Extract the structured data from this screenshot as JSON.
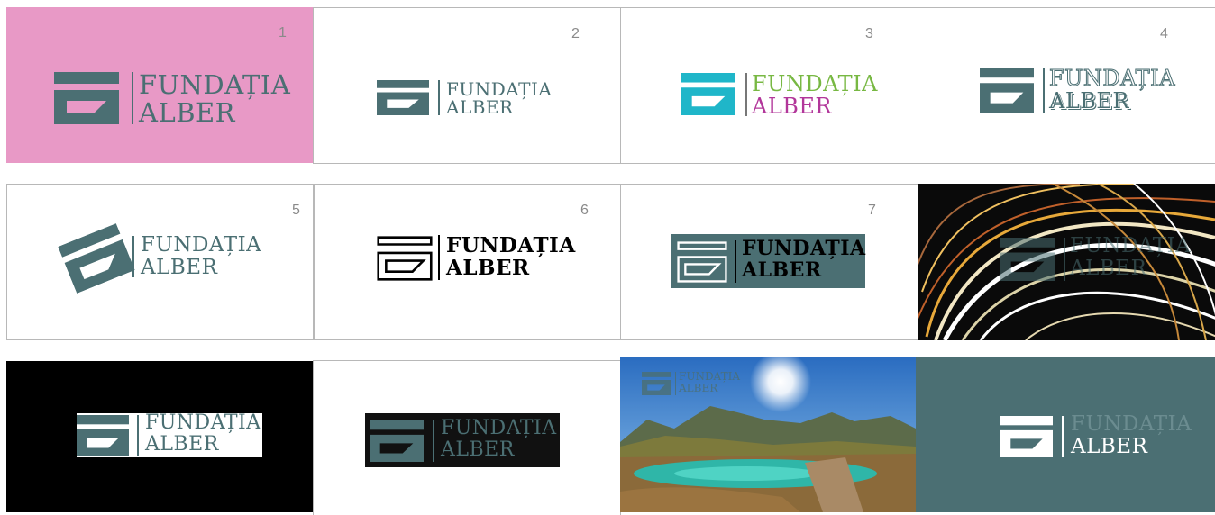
{
  "logo_text": {
    "line1": "FUNDAȚIA",
    "line2": "ALBER"
  },
  "tiles": [
    {
      "number": "1",
      "background": "#e899c6",
      "mark_color": "#4b6f73",
      "text_color": "#4b6f73"
    },
    {
      "number": "2",
      "background": "#ffffff",
      "mark_color": "#4b6f73",
      "text_color": "#4b6f73"
    },
    {
      "number": "3",
      "background": "#ffffff",
      "mark_color": "#1fb6c9",
      "line1_color": "#78b843",
      "line2_color": "#b2369a"
    },
    {
      "number": "4",
      "background": "#ffffff",
      "mark_color": "#4b6f73",
      "text_color": "#4b6f73"
    },
    {
      "number": "5",
      "background": "#ffffff",
      "mark_color": "#4b6f73",
      "text_color": "#4b6f73"
    },
    {
      "number": "6",
      "background": "#ffffff",
      "mark_color": "#000000",
      "text_color": "#000000"
    },
    {
      "number": "7",
      "background": "#ffffff",
      "box_color": "#4b6f73",
      "mark_color": "#ffffff",
      "text_color": "#000000"
    },
    {
      "number": "",
      "background": "#0a0a0a",
      "photo": "light-streaks"
    },
    {
      "number": "",
      "background": "#000000",
      "box_color": "#ffffff",
      "mark_color": "#4b6f73"
    },
    {
      "number": "",
      "background": "#ffffff",
      "box_color": "#111111",
      "mark_color": "#4b6f73"
    },
    {
      "number": "",
      "background": "#3d7bbf",
      "photo": "mountain-lake"
    },
    {
      "number": "",
      "background": "#4b6f73",
      "mark_color": "#ffffff",
      "line1_color": "#6b8c90",
      "line2_color": "#ffffff"
    }
  ]
}
